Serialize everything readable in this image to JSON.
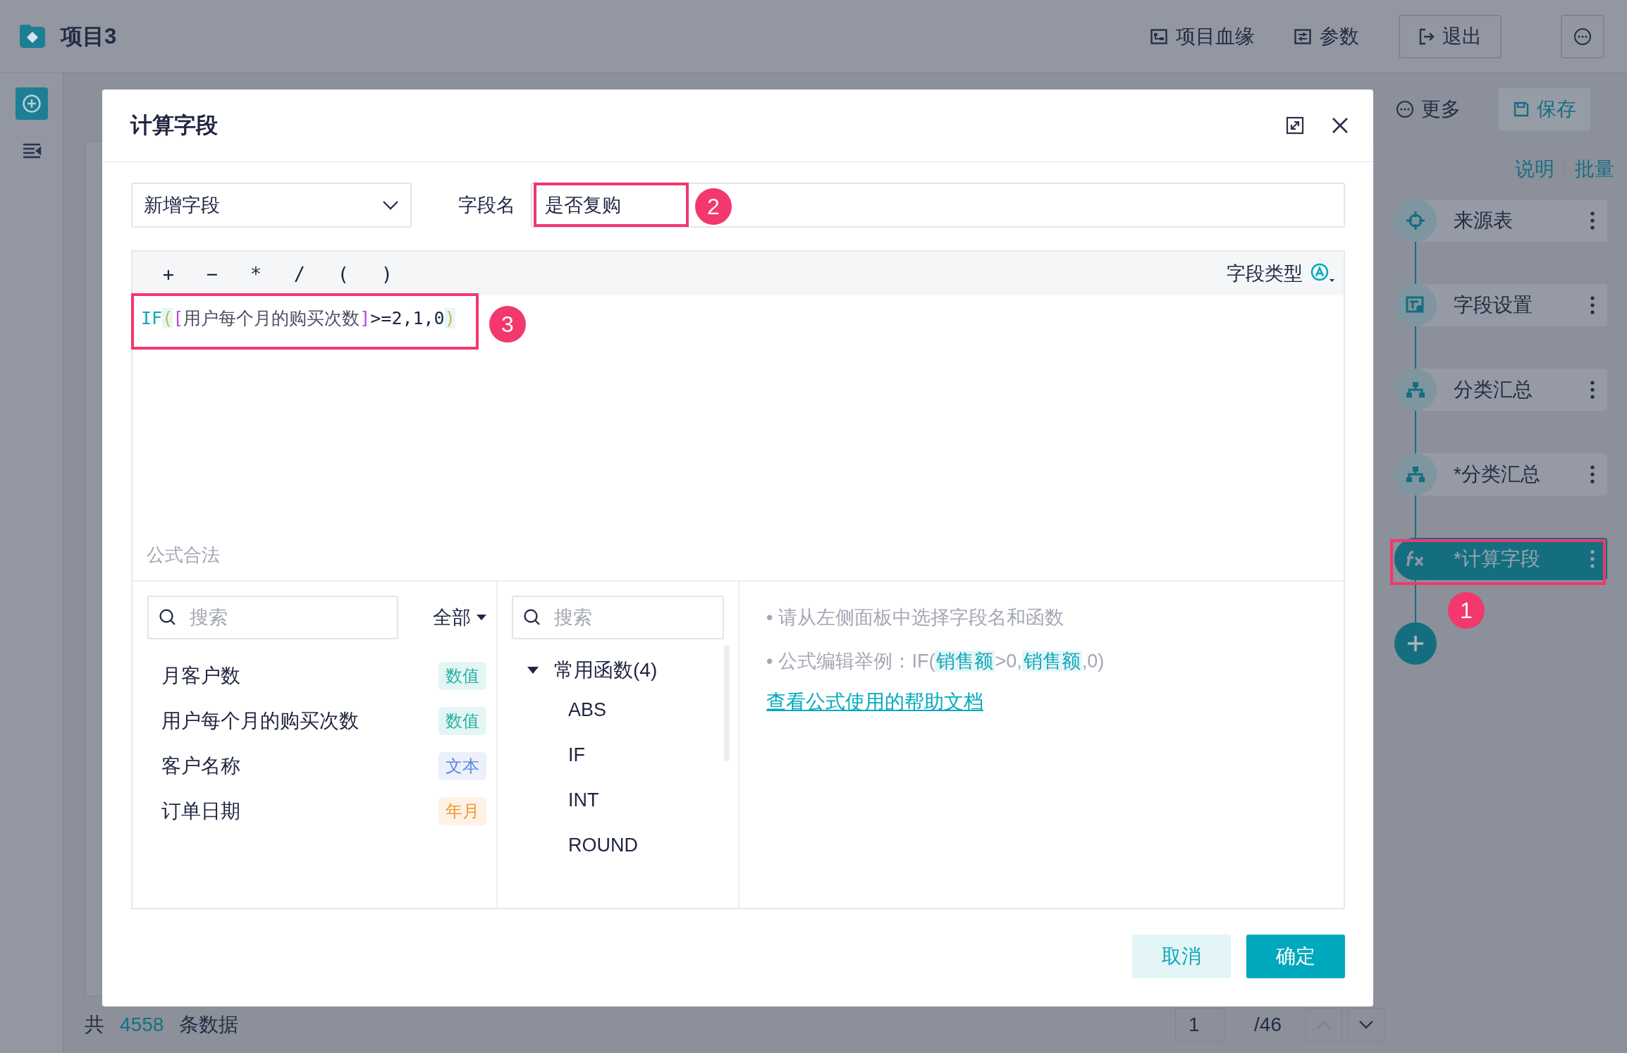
{
  "app": {
    "title": "项目3",
    "top_actions": [
      {
        "kind": "lineage",
        "label": "项目血缘"
      },
      {
        "kind": "params",
        "label": "参数"
      }
    ],
    "exit_button": "退出"
  },
  "toolbar": {
    "more": "更多",
    "save": "保存",
    "links": [
      "说明",
      "批量"
    ]
  },
  "flow": {
    "nodes": [
      {
        "kind": "source",
        "label": "来源表",
        "selected": false
      },
      {
        "kind": "field-settings",
        "label": "字段设置",
        "selected": false
      },
      {
        "kind": "group-summary",
        "label": "分类汇总",
        "selected": false
      },
      {
        "kind": "group-summary",
        "label": "*分类汇总",
        "selected": false
      },
      {
        "kind": "formula",
        "label": "*计算字段",
        "selected": true
      }
    ]
  },
  "footer": {
    "prefix": "共",
    "count": "4558",
    "suffix": "条数据",
    "page": "1",
    "total": "/46"
  },
  "dialog": {
    "title": "计算字段",
    "mode_select": "新增字段",
    "name_label": "字段名",
    "name_value": "是否复购",
    "operators": [
      "+",
      "−",
      "*",
      "/",
      "(",
      ")"
    ],
    "type_label": "字段类型",
    "formula": [
      {
        "kind": "func",
        "text": "IF"
      },
      {
        "kind": "paren",
        "text": "("
      },
      {
        "kind": "bracket",
        "text": "["
      },
      {
        "kind": "field",
        "text": "用户每个月的购买次数"
      },
      {
        "kind": "bracket",
        "text": "]"
      },
      {
        "kind": "plain",
        "text": ">=2,1,0"
      },
      {
        "kind": "paren",
        "text": ")"
      }
    ],
    "status": "公式合法",
    "field_search_placeholder": "搜索",
    "filter": "全部",
    "fields": [
      {
        "name": "月客户数",
        "type": "数值",
        "color": "#25b2a3"
      },
      {
        "name": "用户每个月的购买次数",
        "type": "数值",
        "color": "#25b2a3"
      },
      {
        "name": "客户名称",
        "type": "文本",
        "color": "#5b87dc"
      },
      {
        "name": "订单日期",
        "type": "年月",
        "color": "#f3932e"
      }
    ],
    "function_search_placeholder": "搜索",
    "function_group": {
      "label": "常用函数(4)",
      "expanded": true,
      "items": [
        "ABS",
        "IF",
        "INT",
        "ROUND"
      ]
    },
    "hints": [
      {
        "marker": "•",
        "segments": [
          {
            "kind": "plain",
            "text": "请从左侧面板中选择字段名和函数"
          }
        ]
      },
      {
        "marker": "•",
        "segments": [
          {
            "kind": "plain",
            "text": "公式编辑举例：IF("
          },
          {
            "kind": "field",
            "text": "销售额"
          },
          {
            "kind": "plain",
            "text": ">0,"
          },
          {
            "kind": "field",
            "text": "销售额"
          },
          {
            "kind": "plain",
            "text": ",0)"
          }
        ]
      }
    ],
    "help_link": "查看公式使用的帮助文档",
    "cancel": "取消",
    "ok": "确定"
  },
  "annotations": [
    {
      "number": "1"
    },
    {
      "number": "2"
    },
    {
      "number": "3"
    }
  ]
}
